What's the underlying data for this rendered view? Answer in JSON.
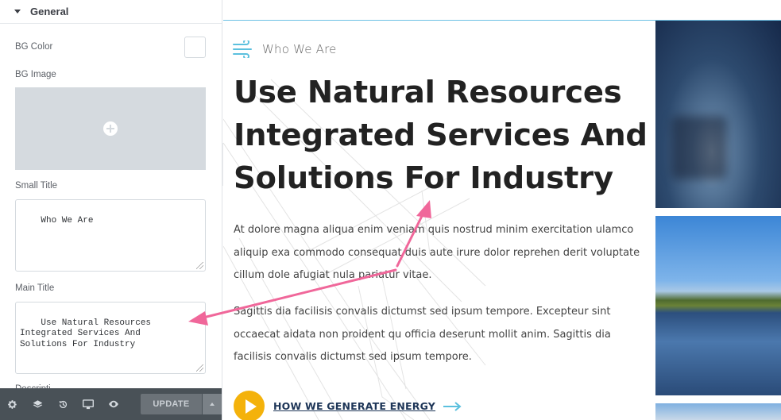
{
  "panel": {
    "section_title": "General",
    "bg_color_label": "BG Color",
    "bg_image_label": "BG Image",
    "small_title_label": "Small Title",
    "small_title_value": "Who We Are",
    "main_title_label": "Main Title",
    "main_title_value": "Use Natural Resources\nIntegrated Services And\nSolutions For Industry",
    "next_label_cut": "Descripti"
  },
  "footer": {
    "update_label": "UPDATE",
    "icons": [
      "settings-icon",
      "layers-icon",
      "history-icon",
      "responsive-icon",
      "preview-eye-icon"
    ]
  },
  "preview": {
    "small_title": "Who We Are",
    "main_title_lines": [
      "Use Natural Resources",
      "Integrated Services And",
      "Solutions For Industry"
    ],
    "para1": "At dolore magna aliqua enim veniam quis nostrud minim exercitation ulamco aliquip exa commodo consequat duis aute irure dolor reprehen derit voluptate cillum dole afugiat nula pariatur vitae.",
    "para2": "Sagittis dia facilisis convalis dictumst sed ipsum tempore. Excepteur sint occaecat aidata non proident qu officia deserunt mollit anim. Sagittis dia facilisis convalis dictumst sed ipsum tempore.",
    "cta_label": "HOW WE GENERATE ENERGY"
  },
  "colors": {
    "accent_yellow": "#f4b20b",
    "accent_cyan": "#5bc0de",
    "annotation_pink": "#f0679a",
    "footer_bg": "#495157"
  }
}
